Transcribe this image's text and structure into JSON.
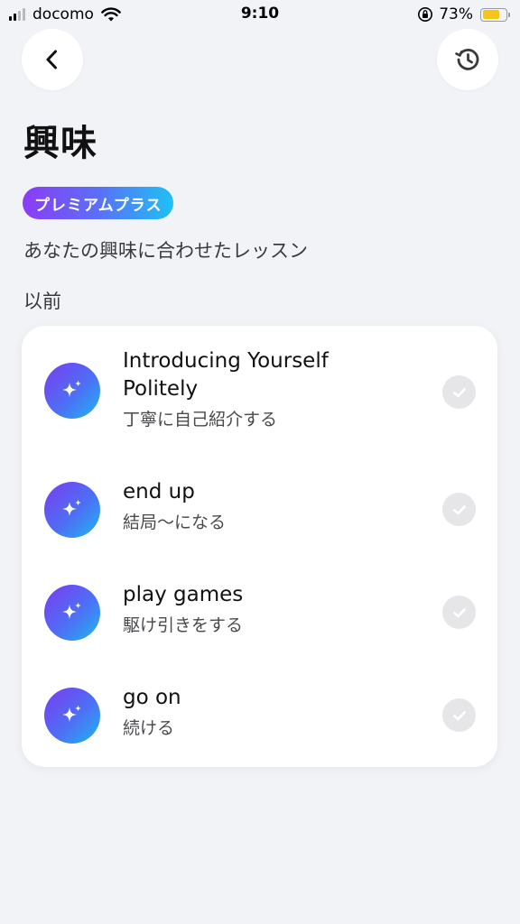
{
  "status_bar": {
    "carrier": "docomo",
    "time": "9:10",
    "battery_percent": "73%",
    "battery_level": 0.73
  },
  "header": {
    "title": "興味",
    "badge": "プレミアムプラス",
    "subtitle": "あなたの興味に合わせたレッスン"
  },
  "section": {
    "label": "以前"
  },
  "lessons": [
    {
      "title": "Introducing Yourself Politely",
      "subtitle": "丁寧に自己紹介する",
      "completed": true
    },
    {
      "title": "end up",
      "subtitle": "結局〜になる",
      "completed": true
    },
    {
      "title": "play games",
      "subtitle": "駆け引きをする",
      "completed": true
    },
    {
      "title": "go on",
      "subtitle": "続ける",
      "completed": true
    }
  ],
  "colors": {
    "background": "#f2f3f7",
    "card": "#ffffff",
    "badge_gradient": [
      "#8b3cf6",
      "#5a6ff8",
      "#1ec1f5"
    ],
    "icon_gradient": [
      "#7b3bf0",
      "#4d6ff5",
      "#1cb7f2"
    ],
    "battery": "#f5c518",
    "check_circle": "#e6e6e8"
  }
}
